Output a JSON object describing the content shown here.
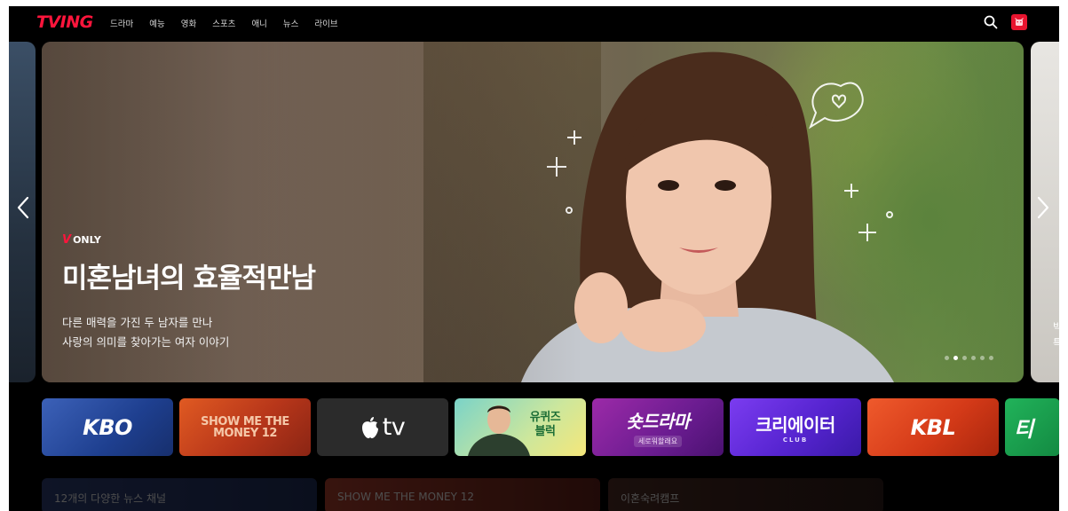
{
  "header": {
    "logo": "TVING",
    "nav": [
      "드라마",
      "예능",
      "영화",
      "스포츠",
      "애니",
      "뉴스",
      "라이브"
    ],
    "search_icon": "search-icon",
    "avatar_icon": "profile-icon"
  },
  "hero": {
    "badge_prefix": "V",
    "badge": "ONLY",
    "title": "미혼남녀의 효율적만남",
    "description_line1": "다른 매력을 가진 두 남자를 만나",
    "description_line2": "사랑의 의미를 찾아가는 여자 이야기",
    "slide_count": 6,
    "active_slide": 2,
    "prev_icon": "chevron-left-icon",
    "next_icon": "chevron-right-icon"
  },
  "peek_right": {
    "line1": "빅",
    "line2": "특"
  },
  "channels": [
    {
      "label": "KBO"
    },
    {
      "label": "SHOW ME THE MONEY 12"
    },
    {
      "label": "tv"
    },
    {
      "label": "유퀴즈 블럭"
    },
    {
      "label": "숏드라마",
      "sub": "세로워할래요"
    },
    {
      "label": "크리에이터",
      "sub": "CLUB"
    },
    {
      "label": "KBL"
    },
    {
      "label": "티"
    }
  ],
  "bottom_row": [
    {
      "label": "12개의 다양한 뉴스 채널"
    },
    {
      "label": "SHOW ME THE MONEY 12"
    },
    {
      "label": "이혼숙려캠프"
    }
  ],
  "colors": {
    "brand_red": "#ff153c",
    "background": "#000000"
  }
}
